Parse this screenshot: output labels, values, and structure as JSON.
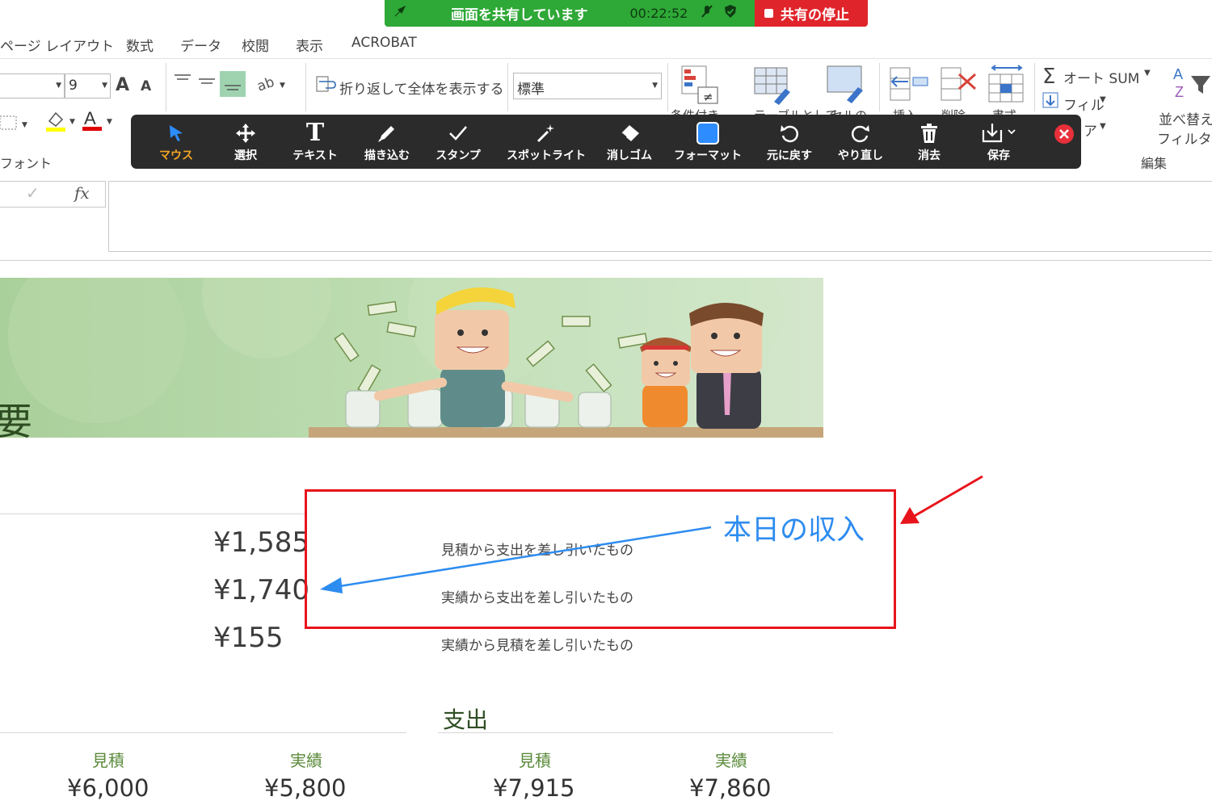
{
  "share_bar": {
    "status": "画面を共有しています",
    "timer": "00:22:52",
    "stop_label": "共有の停止",
    "green": "#2ea836",
    "red": "#e0242b"
  },
  "ribbon": {
    "tabs": [
      "ページ レイアウト",
      "数式",
      "データ",
      "校閲",
      "表示",
      "ACROBAT"
    ],
    "font_size": "9",
    "grow_font": "A",
    "shrink_font": "A",
    "wrap_text_label": "折り返して全体を表示する",
    "number_format": "標準",
    "autosum_label": "オート SUM",
    "fill_label": "フィル",
    "clear_label": "ア",
    "sort_filter_line1": "並べ替え",
    "sort_filter_line2": "フィルター",
    "group_font": "フォント",
    "group_edit": "編集",
    "partial_cond": "条件付き",
    "partial_table": "テーブルとして",
    "partial_cell": "セルの",
    "partial_insert": "挿入",
    "partial_delete": "削除",
    "partial_format": "書式"
  },
  "toolbar": {
    "items": [
      "マウス",
      "選択",
      "テキスト",
      "描き込む",
      "スタンプ",
      "スポットライト",
      "消しゴム",
      "フォーマット",
      "元に戻す",
      "やり直し",
      "消去",
      "保存"
    ],
    "active_color": "#f5a623",
    "format_color": "#2d8cff"
  },
  "formula_bar": {
    "fx": "fx",
    "check": "✓"
  },
  "banner": {
    "title_char": "要"
  },
  "summary": {
    "rows": [
      {
        "amount": "¥1,585",
        "note": "見積から支出を差し引いたもの"
      },
      {
        "amount": "¥1,740",
        "note": "実績から支出を差し引いたもの"
      },
      {
        "amount": "¥155",
        "note": "実績から見積を差し引いたもの"
      }
    ]
  },
  "annotation": {
    "text": "本日の収入",
    "box_color": "#e8141b",
    "text_color": "#2d8cf0"
  },
  "expenses": {
    "title": "支出",
    "left": [
      {
        "label": "見積",
        "value": "¥6,000"
      },
      {
        "label": "実績",
        "value": "¥5,800"
      }
    ],
    "right": [
      {
        "label": "見積",
        "value": "¥7,915"
      },
      {
        "label": "実績",
        "value": "¥7,860"
      }
    ]
  }
}
